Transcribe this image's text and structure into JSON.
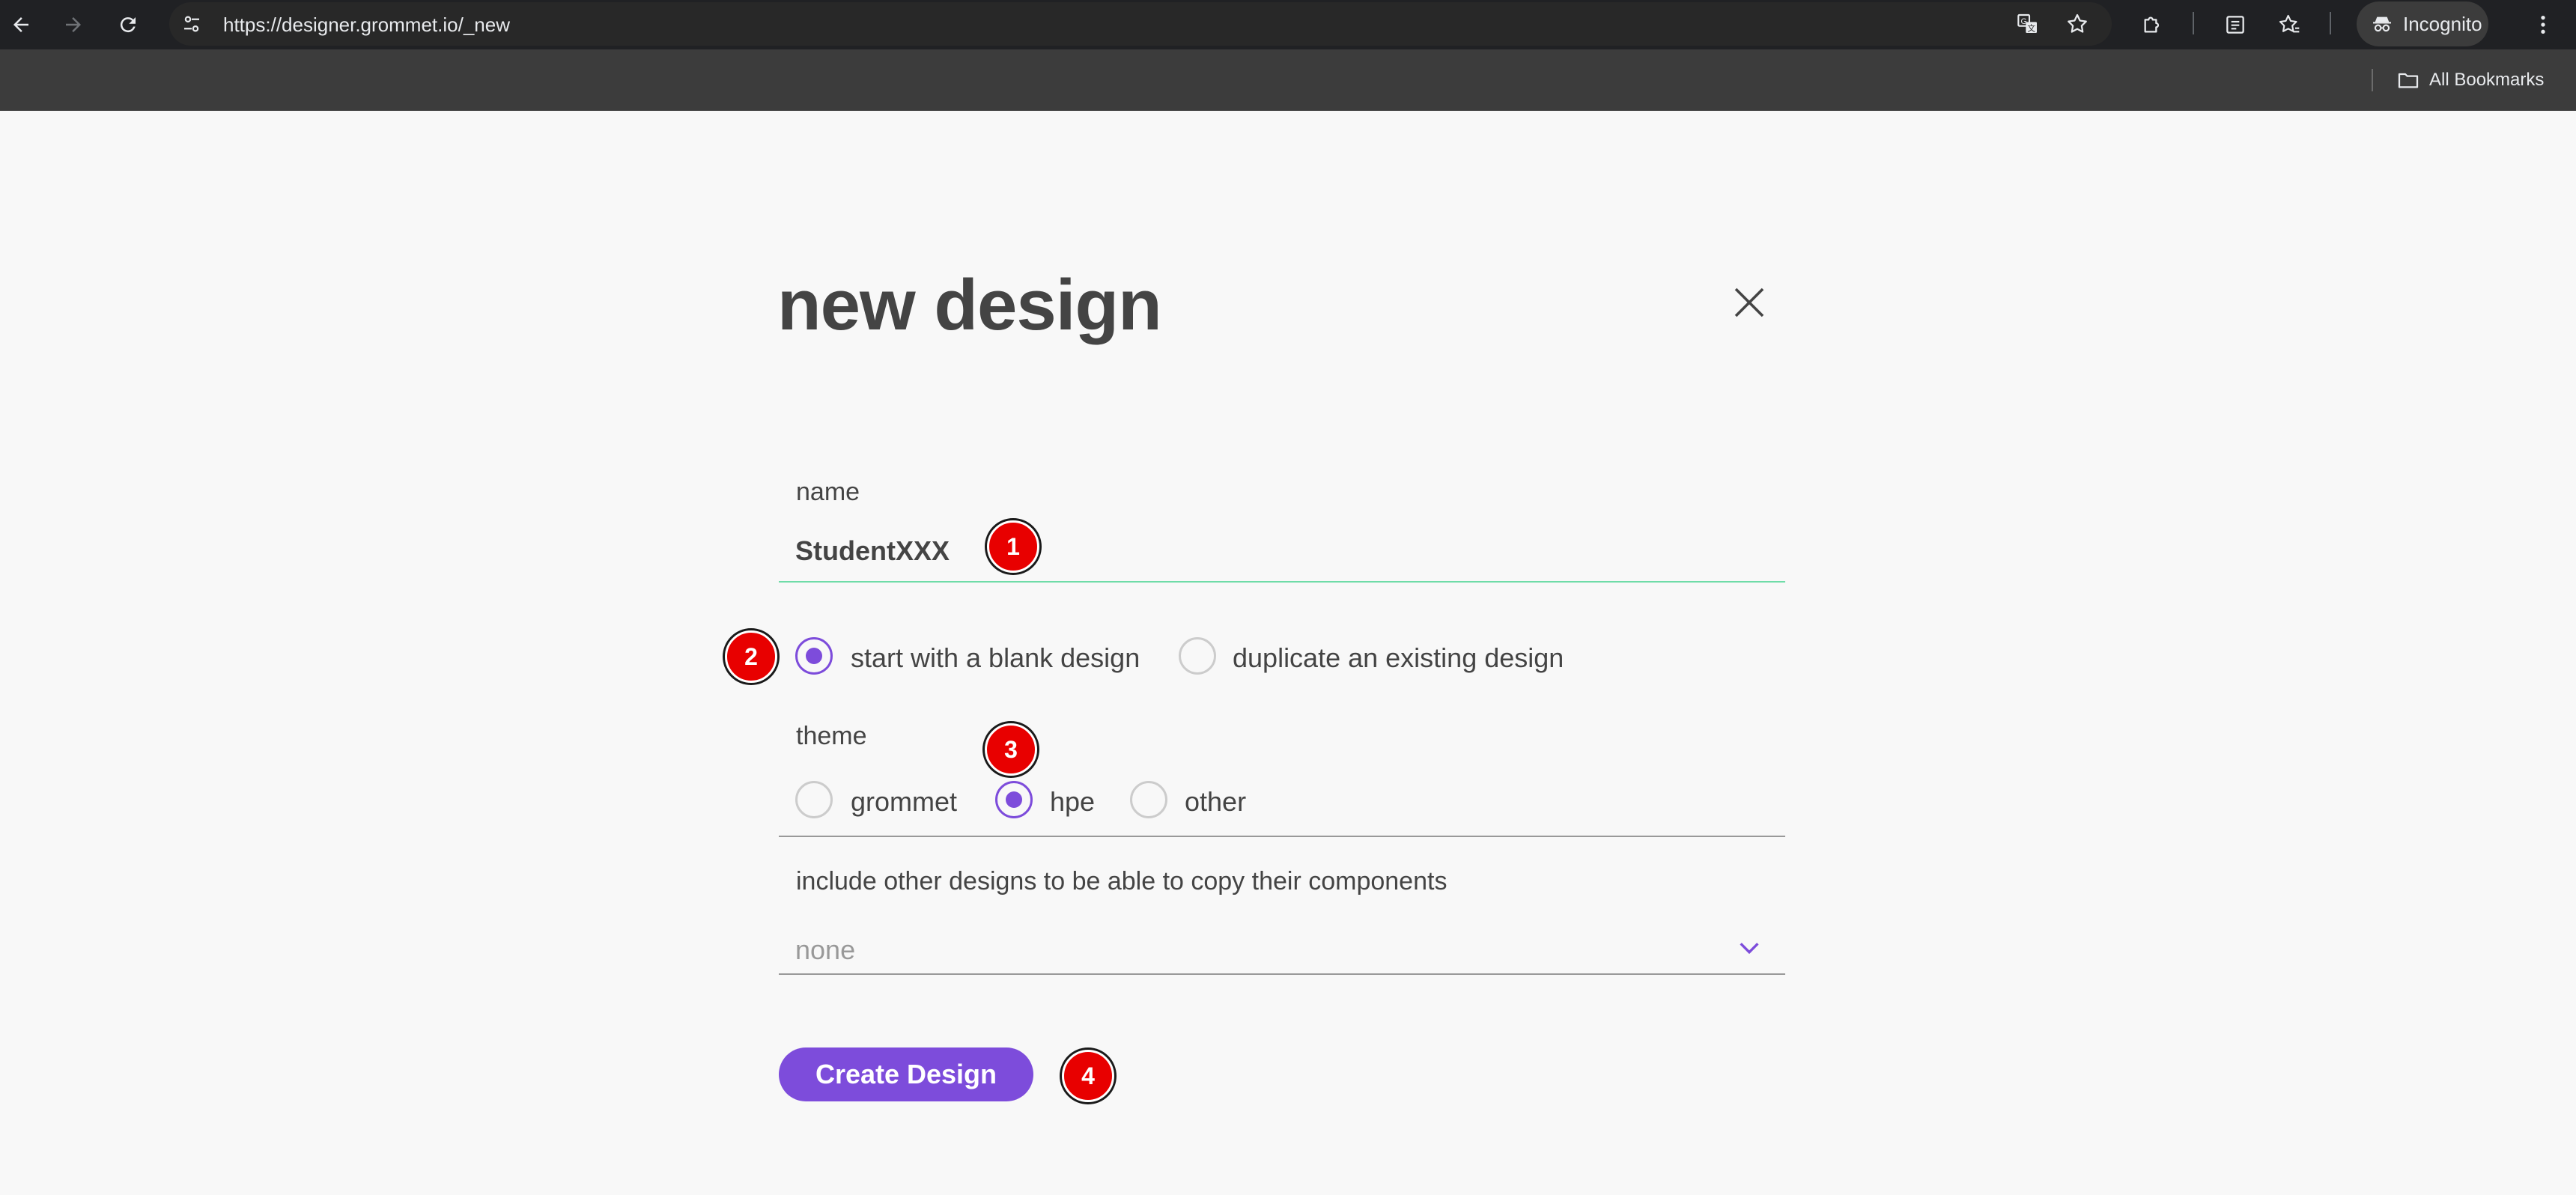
{
  "browser": {
    "url": "https://designer.grommet.io/_new",
    "profile_label": "Incognito",
    "bookmarks_label": "All Bookmarks"
  },
  "page": {
    "title": "new design",
    "name_label": "name",
    "name_value": "StudentXXX",
    "start_options": [
      {
        "label": "start with a blank design",
        "checked": true
      },
      {
        "label": "duplicate an existing design",
        "checked": false
      }
    ],
    "theme_label": "theme",
    "theme_options": [
      {
        "label": "grommet",
        "checked": false
      },
      {
        "label": "hpe",
        "checked": true
      },
      {
        "label": "other",
        "checked": false
      }
    ],
    "include_label": "include other designs to be able to copy their components",
    "include_value": "none",
    "create_button": "Create Design"
  },
  "annotations": [
    "1",
    "2",
    "3",
    "4"
  ],
  "colors": {
    "accent": "#7d4cdb",
    "focus_underline": "#6fdca8",
    "badge": "#e80000",
    "text": "#444444"
  },
  "icons": {
    "back": "back-arrow-icon",
    "forward": "forward-arrow-icon",
    "reload": "reload-icon",
    "site_info": "tune-icon",
    "translate": "translate-icon",
    "bookmark": "star-icon",
    "extensions": "puzzle-icon",
    "reading_list": "reading-list-icon",
    "bookmarks_manager": "star-list-icon",
    "incognito": "incognito-icon",
    "menu": "kebab-menu-icon",
    "folder": "folder-icon",
    "close": "close-icon",
    "chevron": "chevron-down-icon"
  }
}
